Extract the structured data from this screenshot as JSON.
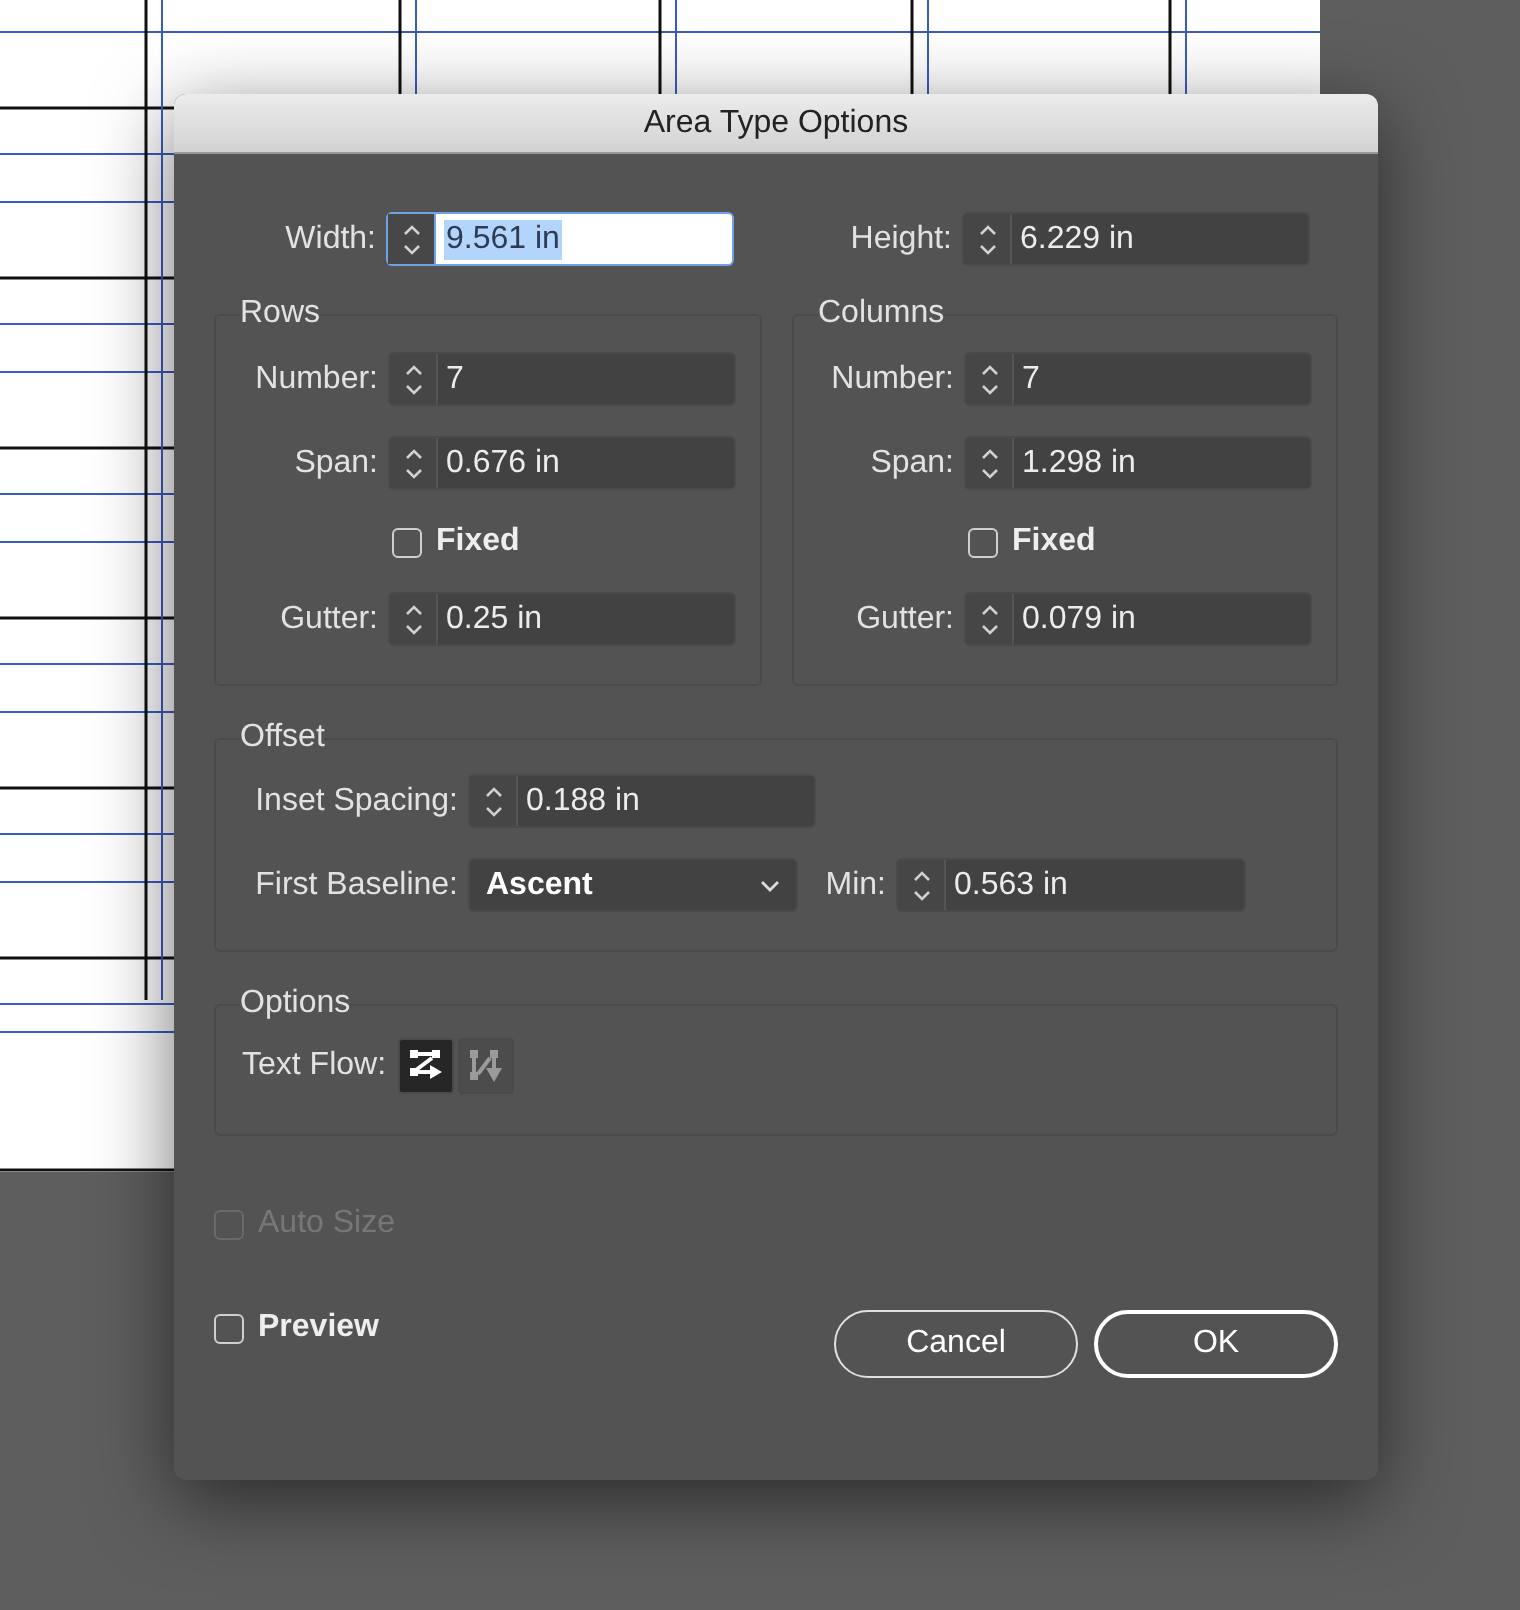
{
  "dialog": {
    "title": "Area Type Options",
    "width": {
      "label": "Width:",
      "value": "9.561 in",
      "focused": true
    },
    "height": {
      "label": "Height:",
      "value": "6.229 in",
      "focused": false
    },
    "rows": {
      "title": "Rows",
      "number": {
        "label": "Number:",
        "value": "7",
        "focused": false
      },
      "span": {
        "label": "Span:",
        "value": "0.676 in",
        "focused": false
      },
      "fixed": {
        "label": "Fixed",
        "checked": false,
        "disabled": false
      },
      "gutter": {
        "label": "Gutter:",
        "value": "0.25 in",
        "focused": false
      }
    },
    "columns": {
      "title": "Columns",
      "number": {
        "label": "Number:",
        "value": "7",
        "focused": false
      },
      "span": {
        "label": "Span:",
        "value": "1.298 in",
        "focused": false
      },
      "fixed": {
        "label": "Fixed",
        "checked": false,
        "disabled": false
      },
      "gutter": {
        "label": "Gutter:",
        "value": "0.079 in",
        "focused": false
      }
    },
    "offset": {
      "title": "Offset",
      "inset_spacing": {
        "label": "Inset Spacing:",
        "value": "0.188 in",
        "focused": false
      },
      "first_baseline": {
        "label": "First Baseline:",
        "value": "Ascent"
      },
      "min": {
        "label": "Min:",
        "value": "0.563 in",
        "focused": false
      }
    },
    "options": {
      "title": "Options",
      "text_flow": {
        "label": "Text Flow:",
        "buttons": [
          {
            "kind": "rows",
            "selected": true
          },
          {
            "kind": "columns",
            "selected": false
          }
        ]
      }
    },
    "auto_size": {
      "label": "Auto Size",
      "checked": false,
      "disabled": true
    },
    "preview": {
      "label": "Preview",
      "checked": false,
      "disabled": false
    },
    "buttons": [
      {
        "label": "Cancel",
        "default": false
      },
      {
        "label": "OK",
        "default": true
      }
    ]
  }
}
